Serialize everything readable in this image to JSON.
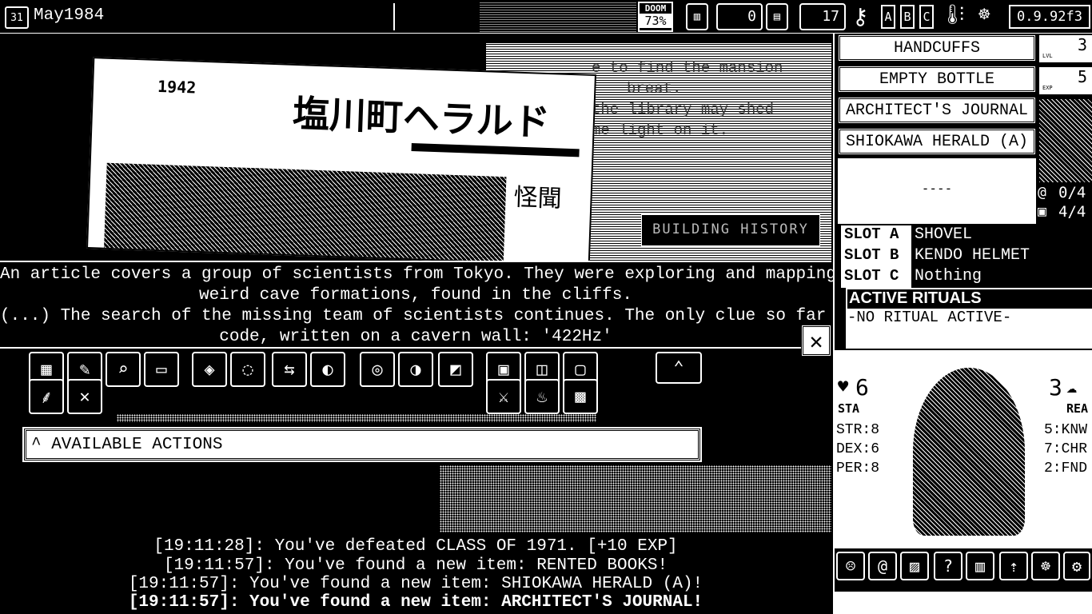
{
  "topbar": {
    "calendar_day": "31",
    "date": "May1984",
    "doom_label": "DOOM",
    "doom_value": "73%",
    "funds": "0",
    "ammo": "17",
    "letters": [
      "A",
      "B",
      "C"
    ],
    "version": "0.9.92f3"
  },
  "inventory": {
    "items": [
      "HANDCUFFS",
      "EMPTY BOTTLE",
      "ARCHITECT'S JOURNAL",
      "SHIOKAWA HERALD (A)"
    ],
    "empty_slot": "----",
    "level_label": "LVL",
    "level": "3",
    "exp_label": "EXP",
    "exp": "5",
    "spells": "0/4",
    "inventory_count": "4/4"
  },
  "equipment": {
    "slots": [
      {
        "key": "SLOT A",
        "value": "SHOVEL"
      },
      {
        "key": "SLOT B",
        "value": "KENDO HELMET"
      },
      {
        "key": "SLOT C",
        "value": "Nothing"
      }
    ]
  },
  "rituals": {
    "title": "ACTIVE RITUALS",
    "value": "-NO RITUAL ACTIVE-"
  },
  "character": {
    "stamina": "6",
    "stamina_label": "STA",
    "reason": "3",
    "reason_label": "REA",
    "stats_left": [
      "STR:8",
      "DEX:6",
      "PER:8"
    ],
    "stats_right": [
      "5:KNW",
      "7:CHR",
      "2:FND"
    ]
  },
  "scene": {
    "newspaper_year": "1942",
    "newspaper_title": "塩川町ヘラルド",
    "newspaper_sub": "怪聞",
    "caption": "BUILDING HISTORY",
    "note_lines": [
      "e to find the mansion",
      "breat.",
      "the library may shed",
      "me light on it."
    ]
  },
  "description": {
    "lines": [
      "An article covers a group of scientists from Tokyo. They were exploring and mapping",
      "weird cave formations, found in the cliffs.",
      "(...) The search of the missing team of scientists continues. The only clue so far is a",
      "code, written on a cavern wall: '422Hz'"
    ],
    "close_label": "✕"
  },
  "actions": {
    "label": "^ AVAILABLE ACTIONS"
  },
  "log": [
    "[19:11:28]: You've defeated CLASS OF 1971. [+10 EXP]",
    "[19:11:57]: You've found a new item: RENTED BOOKS!",
    "[19:11:57]: You've found a new item: SHIOKAWA HERALD (A)!",
    "[19:11:57]: You've found a new item: ARCHITECT'S JOURNAL!"
  ]
}
